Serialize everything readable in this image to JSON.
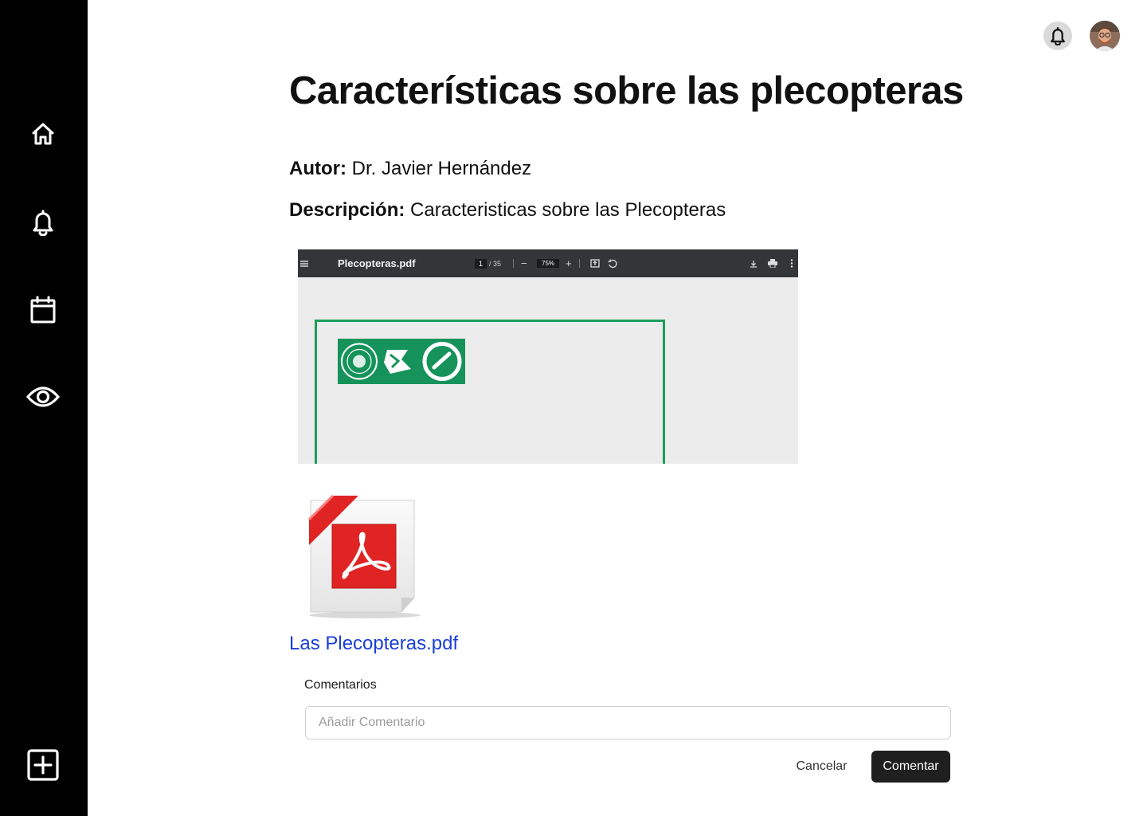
{
  "sidebar": {
    "items": [
      {
        "icon": "home-icon"
      },
      {
        "icon": "bell-icon"
      },
      {
        "icon": "calendar-icon"
      },
      {
        "icon": "eye-icon"
      }
    ],
    "bottom_action": {
      "icon": "plus-square-icon"
    }
  },
  "header": {
    "notification_icon": "bell-icon",
    "avatar": "user-avatar"
  },
  "document": {
    "title": "Características sobre las plecopteras",
    "author_label": "Autor:",
    "author": "Dr. Javier Hernández",
    "description_label": "Descripción:",
    "description": "Caracteristicas sobre las Plecopteras"
  },
  "pdf_viewer": {
    "filename": "Plecopteras.pdf",
    "current_page": "1",
    "total_pages": "/ 35",
    "zoom": "75%",
    "zoom_out": "−",
    "zoom_in": "+"
  },
  "attachment": {
    "icon": "pdf-file-icon",
    "link_text": "Las Plecopteras.pdf"
  },
  "comments": {
    "label": "Comentarios",
    "placeholder": "Añadir Comentario",
    "value": "",
    "cancel_label": "Cancelar",
    "submit_label": "Comentar"
  },
  "colors": {
    "sidebar_bg": "#000000",
    "primary_button": "#1f1f1f",
    "link": "#1a3fd6",
    "pdf_accent_green": "#15935a",
    "pdf_toolbar": "#323639"
  }
}
